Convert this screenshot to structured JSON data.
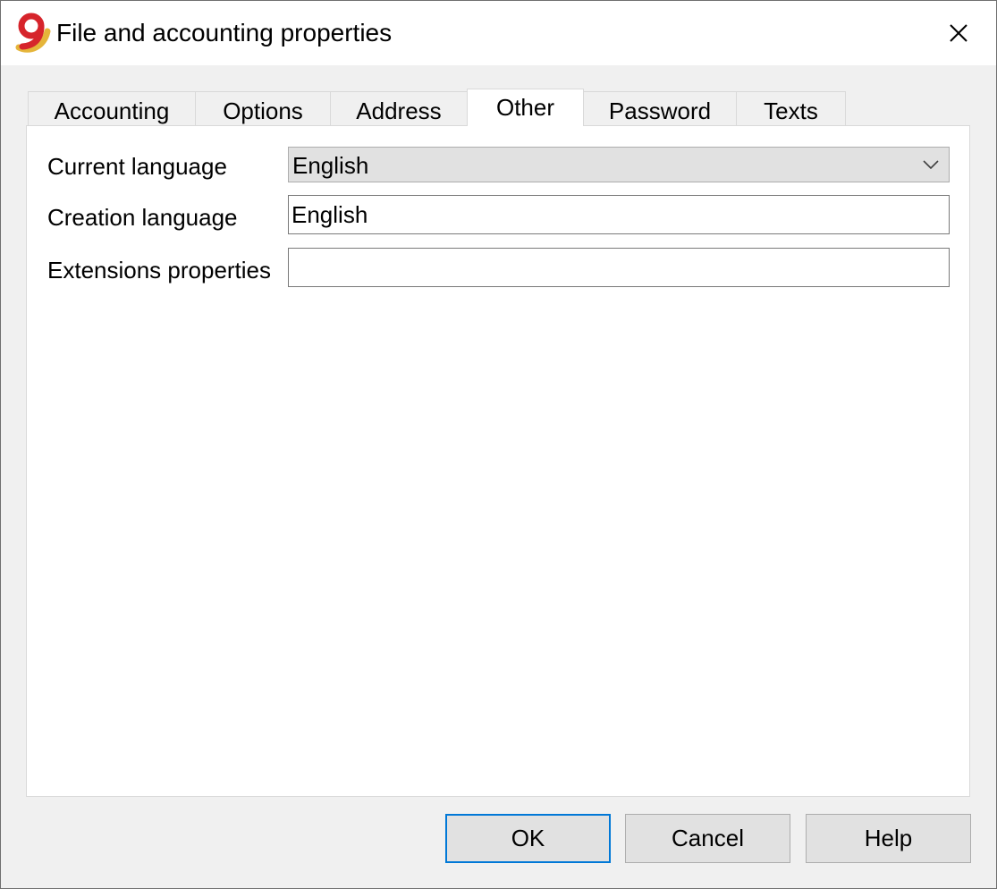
{
  "window": {
    "title": "File and accounting properties",
    "icon": "banana-9-app-icon"
  },
  "tabs": [
    {
      "label": "Accounting",
      "active": false
    },
    {
      "label": "Options",
      "active": false
    },
    {
      "label": "Address",
      "active": false
    },
    {
      "label": "Other",
      "active": true
    },
    {
      "label": "Password",
      "active": false
    },
    {
      "label": "Texts",
      "active": false
    }
  ],
  "fields": {
    "current_language": {
      "label": "Current language",
      "value": "English"
    },
    "creation_language": {
      "label": "Creation language",
      "value": "English"
    },
    "extensions_properties": {
      "label": "Extensions properties",
      "value": ""
    }
  },
  "buttons": {
    "ok": "OK",
    "cancel": "Cancel",
    "help": "Help"
  },
  "colors": {
    "default_button_border": "#0078d7",
    "app_icon_red": "#d6242b",
    "app_icon_gold": "#e5b53a"
  }
}
